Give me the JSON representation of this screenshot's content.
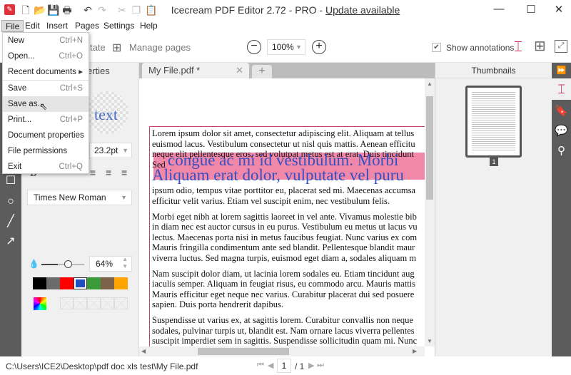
{
  "app": {
    "title": "Icecream PDF Editor 2.72 - PRO - ",
    "update_link": "Update available"
  },
  "menubar": [
    "File",
    "Edit",
    "Insert",
    "Pages",
    "Settings",
    "Help"
  ],
  "file_menu": [
    {
      "label": "New",
      "shortcut": "Ctrl+N"
    },
    {
      "label": "Open...",
      "shortcut": "Ctrl+O"
    },
    {
      "label": "Recent documents",
      "shortcut": "▸"
    },
    {
      "label": "Save",
      "shortcut": "Ctrl+S"
    },
    {
      "label": "Save as...",
      "shortcut": ""
    },
    {
      "label": "Print...",
      "shortcut": "Ctrl+P"
    },
    {
      "label": "Document properties",
      "shortcut": ""
    },
    {
      "label": "File permissions",
      "shortcut": ""
    },
    {
      "label": "Exit",
      "shortcut": "Ctrl+Q"
    }
  ],
  "toolbar": {
    "annotate_partial": "tate",
    "manage_pages": "Manage pages",
    "zoom": "100%",
    "show_annotations": "Show annotations",
    "show_annotations_checked": true
  },
  "props": {
    "tab_partial": "erties",
    "preview": "text",
    "font_size": "23.2pt",
    "font": "Times New Roman",
    "opacity": "64%",
    "opacity_value": 64,
    "colors": [
      "#000000",
      "#6b6b6b",
      "#ff0000",
      "#1f4fbf",
      "#3a9a3a",
      "#7a6148",
      "#ffa500"
    ],
    "selected_color": "#1f4fbf"
  },
  "tabs": [
    {
      "label": "My File.pdf *"
    }
  ],
  "document": {
    "para1": [
      "Lorem ipsum dolor sit amet, consectetur adipiscing elit. Aliquam at tellus",
      "euismod lacus. Vestibulum consectetur ut nisl quis mattis. Aenean efficitu",
      "neque elit pellentesque eros, sed volutpat metus est at erat. Duis tincidunt",
      "Sed"
    ],
    "annot": [
      "congue ac mi id vestibulum. Morbi",
      "Aliquam erat dolor, vulputate vel puru"
    ],
    "para1b": [
      "ipsum odio, tempus vitae porttitor eu, placerat sed mi. Maecenas accumsa",
      "efficitur velit varius. Etiam vel suscipit enim, nec vestibulum felis."
    ],
    "para2": [
      "Morbi eget nibh at lorem sagittis laoreet in vel ante. Vivamus molestie bib",
      "in diam nec est auctor cursus in eu purus. Vestibulum eu metus ut lacus vu",
      "lectus. Maecenas porta nisi in metus faucibus feugiat. Nunc varius ex com",
      "Mauris fringilla condimentum ante sed blandit. Pellentesque blandit maur",
      "viverra luctus. Sed magna turpis, euismod eget diam a, sodales aliquam m"
    ],
    "para3": [
      "Nam suscipit dolor diam, ut lacinia lorem sodales eu. Etiam tincidunt aug",
      "iaculis semper. Aliquam in feugiat risus, eu commodo arcu. Mauris mattis",
      "Mauris efficitur eget neque nec varius. Curabitur placerat dui sed posuere",
      "sapien. Duis porta hendrerit dapibus."
    ],
    "para4": [
      "Suspendisse ut varius ex, at sagittis lorem. Curabitur convallis non neque",
      "sodales, pulvinar turpis ut, blandit est. Nam ornare lacus viverra pellentes",
      "suscipit imperdiet sem in sagittis. Suspendisse sollicitudin quam mi. Nunc"
    ]
  },
  "thumbnails": {
    "title": "Thumbnails",
    "page_label": "1"
  },
  "status": {
    "path": "C:\\Users\\ICE2\\Desktop\\pdf doc xls test\\My File.pdf",
    "page": "1",
    "total": "/ 1"
  },
  "accent": "#d0335a"
}
